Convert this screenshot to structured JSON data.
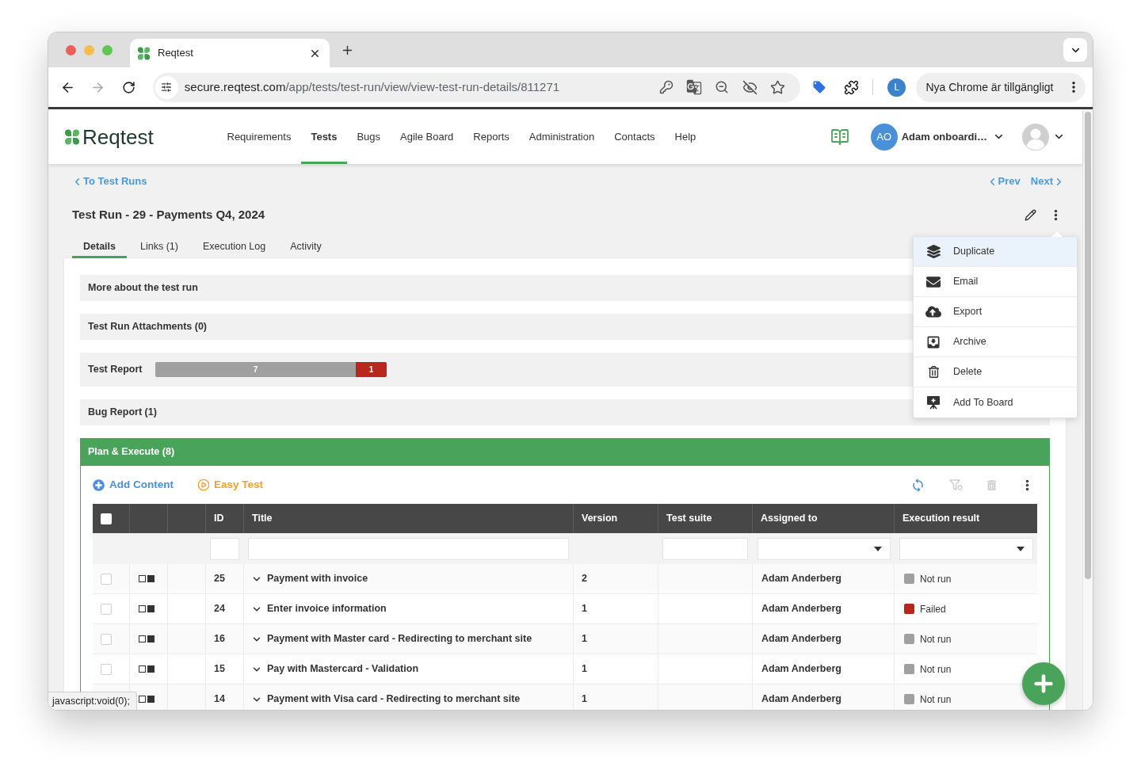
{
  "browser": {
    "tab_title": "Reqtest",
    "url_host": "secure.reqtest.com",
    "url_path": "/app/tests/test-run/view/view-test-run-details/811271",
    "forward_disabled": true,
    "profile_initial": "L",
    "update_label": "Nya Chrome är tillgängligt",
    "status_text": "javascript:void(0);"
  },
  "header": {
    "logo": "Reqtest",
    "nav": [
      {
        "label": "Requirements",
        "selected": false
      },
      {
        "label": "Tests",
        "selected": true
      },
      {
        "label": "Bugs",
        "selected": false
      },
      {
        "label": "Agile Board",
        "selected": false
      },
      {
        "label": "Reports",
        "selected": false
      },
      {
        "label": "Administration",
        "selected": false
      },
      {
        "label": "Contacts",
        "selected": false
      },
      {
        "label": "Help",
        "selected": false
      }
    ],
    "account": {
      "initials": "AO",
      "name": "Adam onboardi…"
    }
  },
  "page": {
    "back_link": "To Test Runs",
    "prev": "Prev",
    "next": "Next",
    "title": "Test Run - 29 - Payments Q4, 2024",
    "tabs": [
      {
        "label": "Details",
        "selected": true
      },
      {
        "label": "Links (1)",
        "selected": false
      },
      {
        "label": "Execution Log",
        "selected": false
      },
      {
        "label": "Activity",
        "selected": false
      }
    ]
  },
  "sections": [
    {
      "kind": "panel",
      "title": "More about the test run"
    },
    {
      "kind": "panel",
      "title": "Test Run Attachments (0)"
    },
    {
      "kind": "report",
      "title": "Test Report",
      "segments": [
        {
          "label": "7",
          "color": "#a0a0a0",
          "level": 0.866
        },
        {
          "label": "1",
          "color": "#b8261d",
          "level": 0.134
        }
      ]
    },
    {
      "kind": "panel",
      "title": "Bug Report (1)"
    }
  ],
  "plan": {
    "title": "Plan & Execute (8)",
    "actions": [
      {
        "kind": "add",
        "label": "Add Content"
      },
      {
        "kind": "play",
        "label": "Easy Test"
      }
    ],
    "tools": [
      {
        "disabled": false
      },
      {
        "disabled": true
      },
      {
        "disabled": true
      }
    ],
    "table": {
      "select_all": {
        "checked": false
      },
      "columns": [
        {
          "label": "ID",
          "kind": "text"
        },
        {
          "label": "Title",
          "kind": "text"
        },
        {
          "label": "Version",
          "kind": "none"
        },
        {
          "label": "Test suite",
          "kind": "text"
        },
        {
          "label": "Assigned to",
          "kind": "select"
        },
        {
          "label": "Execution result",
          "kind": "select"
        }
      ],
      "rows": [
        {
          "checked": false,
          "id": "25",
          "title": "Payment with invoice",
          "version": "2",
          "assigned_to": "Adam Anderberg",
          "result": {
            "label": "Not run",
            "color": "#a0a0a0"
          }
        },
        {
          "checked": false,
          "id": "24",
          "title": "Enter invoice information",
          "version": "1",
          "assigned_to": "Adam Anderberg",
          "result": {
            "label": "Failed",
            "color": "#b8261d"
          }
        },
        {
          "checked": false,
          "id": "16",
          "title": "Payment with Master card - Redirecting to merchant site",
          "version": "1",
          "assigned_to": "Adam Anderberg",
          "result": {
            "label": "Not run",
            "color": "#a0a0a0"
          }
        },
        {
          "checked": false,
          "id": "15",
          "title": "Pay with Mastercard - Validation",
          "version": "1",
          "assigned_to": "Adam Anderberg",
          "result": {
            "label": "Not run",
            "color": "#a0a0a0"
          }
        },
        {
          "id": "14",
          "title": "Payment with Visa card - Redirecting to merchant site",
          "version": "1",
          "assigned_to": "Adam Anderberg",
          "result": {
            "label": "Not run",
            "color": "#a0a0a0"
          }
        }
      ]
    }
  },
  "actions_menu": {
    "items": [
      {
        "label": "Duplicate",
        "selected": true
      },
      {
        "label": "Email",
        "selected": false
      },
      {
        "label": "Export",
        "selected": false
      },
      {
        "label": "Archive",
        "selected": false
      },
      {
        "label": "Delete",
        "selected": false
      },
      {
        "label": "Add To Board",
        "selected": false
      }
    ]
  }
}
